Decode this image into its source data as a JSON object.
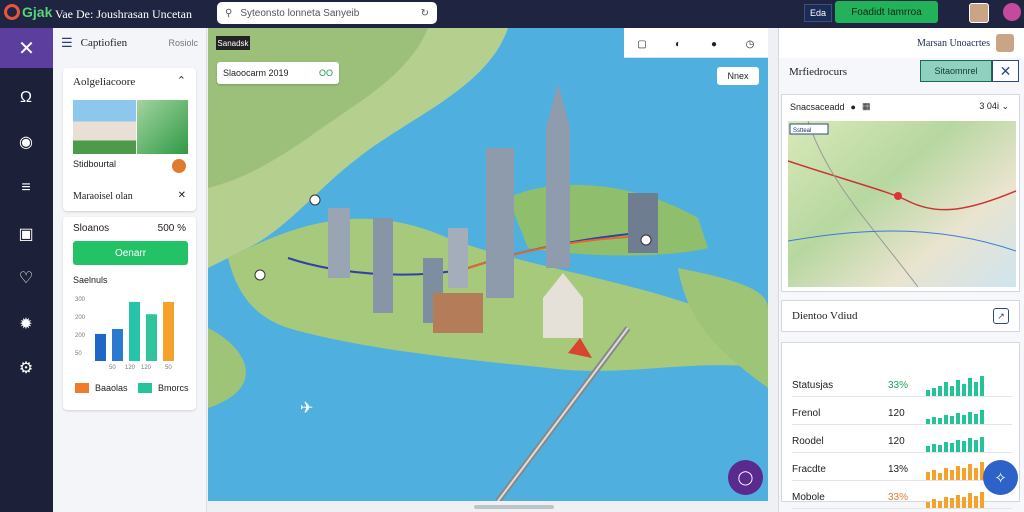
{
  "topbar": {
    "logo_text": "Gjak",
    "app_title": "Vae De: Joushrasan Uncetan",
    "search_placeholder": "Syteonsto lonneta Sanyeib",
    "badge": "Eda",
    "primary_button": "Foadidt Iamrroa"
  },
  "left_panel": {
    "title": "Captiofien",
    "tag": "Rosiolc",
    "card1": {
      "title": "Aolgeliacoore",
      "caption": "Stidbourtal",
      "subtitle": "Maraoisel olan"
    },
    "card2": {
      "header": "Sloanos",
      "percent": "500 %",
      "button": "Oenarr",
      "chart_label": "Saelnuls",
      "chart_ticks": [
        "300",
        "200",
        "200",
        "50"
      ],
      "chart_xlabels": [
        "50",
        "120",
        "120",
        "50"
      ],
      "legend": [
        {
          "label": "Baaolas",
          "color": "#f07b2a"
        },
        {
          "label": "Bmorcs",
          "color": "#26c49a"
        }
      ]
    }
  },
  "mini_chart_data": {
    "type": "bar",
    "values": [
      55,
      65,
      120,
      95,
      120
    ],
    "colors": [
      "#1f67c4",
      "#2a7ad0",
      "#26c4a8",
      "#2fc49a",
      "#f5a12a"
    ]
  },
  "map": {
    "chip": "Sanadsk",
    "pill_text": "Slaoocarm 2019",
    "pill_option": "OO",
    "zoom_button": "Nnex"
  },
  "right_panel": {
    "top_name": "Marsan Unoacrtes",
    "heading": "Mrfiedrocurs",
    "green_button": "Sitaomnrel",
    "map_card": {
      "row_label": "Snacsaceadd",
      "amount": "3 04i",
      "chip": "Sstteal"
    },
    "section_title": "Dientoo Vdiud",
    "stats": [
      {
        "label": "Statusjas",
        "value": "33%",
        "value_color": "#1a9e55",
        "bar_color": "#23c49a"
      },
      {
        "label": "Frenol",
        "value": "120",
        "value_color": "#222",
        "bar_color": "#23c49a"
      },
      {
        "label": "Roodel",
        "value": "120",
        "value_color": "#222",
        "bar_color": "#23c49a"
      },
      {
        "label": "Fracdte",
        "value": "13%",
        "value_color": "#222",
        "bar_color": "#f5a12a"
      },
      {
        "label": "Mobole",
        "value": "33%",
        "value_color": "#e07a2e",
        "bar_color": "#f5a12a"
      }
    ]
  }
}
